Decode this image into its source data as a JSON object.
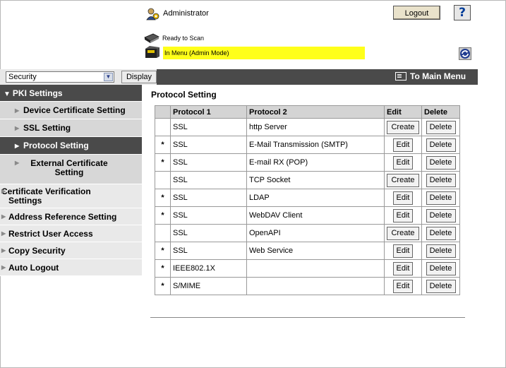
{
  "header": {
    "user_label": "Administrator",
    "logout_label": "Logout",
    "help_label": "?",
    "status_ready": "Ready to Scan",
    "status_menu": "In Menu (Admin Mode)",
    "menu_highlight_color": "#ffff1a"
  },
  "topbar": {
    "select_value": "Security",
    "display_label": "Display",
    "main_menu_label": "To Main Menu"
  },
  "sidebar": {
    "items": [
      {
        "label": "PKI Settings",
        "type": "header"
      },
      {
        "label": "Device Certificate Setting",
        "type": "sub"
      },
      {
        "label": "SSL Setting",
        "type": "sub"
      },
      {
        "label": "Protocol Setting",
        "type": "sub",
        "active": true
      },
      {
        "label": "External Certificate Setting",
        "type": "sub"
      },
      {
        "label": "Certificate Verification Settings",
        "type": "top"
      },
      {
        "label": "Address Reference Setting",
        "type": "top"
      },
      {
        "label": "Restrict User Access",
        "type": "top"
      },
      {
        "label": "Copy Security",
        "type": "top"
      },
      {
        "label": "Auto Logout",
        "type": "top"
      }
    ]
  },
  "content": {
    "title": "Protocol Setting",
    "columns": [
      "",
      "Protocol 1",
      "Protocol 2",
      "Edit",
      "Delete"
    ],
    "rows": [
      {
        "star": "",
        "p1": "SSL",
        "p2": "http Server",
        "edit": "Create",
        "del": "Delete"
      },
      {
        "star": "*",
        "p1": "SSL",
        "p2": "E-Mail Transmission (SMTP)",
        "edit": "Edit",
        "del": "Delete"
      },
      {
        "star": "*",
        "p1": "SSL",
        "p2": "E-mail RX (POP)",
        "edit": "Edit",
        "del": "Delete"
      },
      {
        "star": "",
        "p1": "SSL",
        "p2": "TCP Socket",
        "edit": "Create",
        "del": "Delete"
      },
      {
        "star": "*",
        "p1": "SSL",
        "p2": "LDAP",
        "edit": "Edit",
        "del": "Delete"
      },
      {
        "star": "*",
        "p1": "SSL",
        "p2": "WebDAV Client",
        "edit": "Edit",
        "del": "Delete"
      },
      {
        "star": "",
        "p1": "SSL",
        "p2": "OpenAPI",
        "edit": "Create",
        "del": "Delete"
      },
      {
        "star": "*",
        "p1": "SSL",
        "p2": "Web Service",
        "edit": "Edit",
        "del": "Delete"
      },
      {
        "star": "*",
        "p1": "IEEE802.1X",
        "p2": "",
        "edit": "Edit",
        "del": "Delete"
      },
      {
        "star": "*",
        "p1": "S/MIME",
        "p2": "",
        "edit": "Edit",
        "del": "Delete"
      }
    ]
  }
}
